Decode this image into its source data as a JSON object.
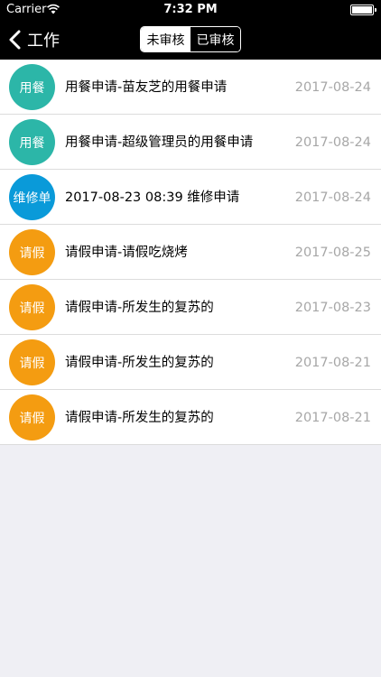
{
  "status_bar": {
    "carrier": "Carrier",
    "time": "7:32 PM"
  },
  "nav": {
    "back_label": "工作",
    "segments": [
      "未审核",
      "已审核"
    ],
    "selected_segment": 0
  },
  "colors": {
    "teal": "#2cb6a8",
    "blue": "#0a9ad9",
    "orange": "#f49c11"
  },
  "items": [
    {
      "badge": "用餐",
      "badge_color": "#2cb6a8",
      "title": "用餐申请-苗友芝的用餐申请",
      "date": "2017-08-24"
    },
    {
      "badge": "用餐",
      "badge_color": "#2cb6a8",
      "title": "用餐申请-超级管理员的用餐申请",
      "date": "2017-08-24"
    },
    {
      "badge": "维修单",
      "badge_color": "#0a9ad9",
      "title": "2017-08-23 08:39 维修申请",
      "date": "2017-08-24"
    },
    {
      "badge": "请假",
      "badge_color": "#f49c11",
      "title": "请假申请-请假吃烧烤",
      "date": "2017-08-25"
    },
    {
      "badge": "请假",
      "badge_color": "#f49c11",
      "title": "请假申请-所发生的复苏的",
      "date": "2017-08-23"
    },
    {
      "badge": "请假",
      "badge_color": "#f49c11",
      "title": "请假申请-所发生的复苏的",
      "date": "2017-08-21"
    },
    {
      "badge": "请假",
      "badge_color": "#f49c11",
      "title": "请假申请-所发生的复苏的",
      "date": "2017-08-21"
    }
  ]
}
